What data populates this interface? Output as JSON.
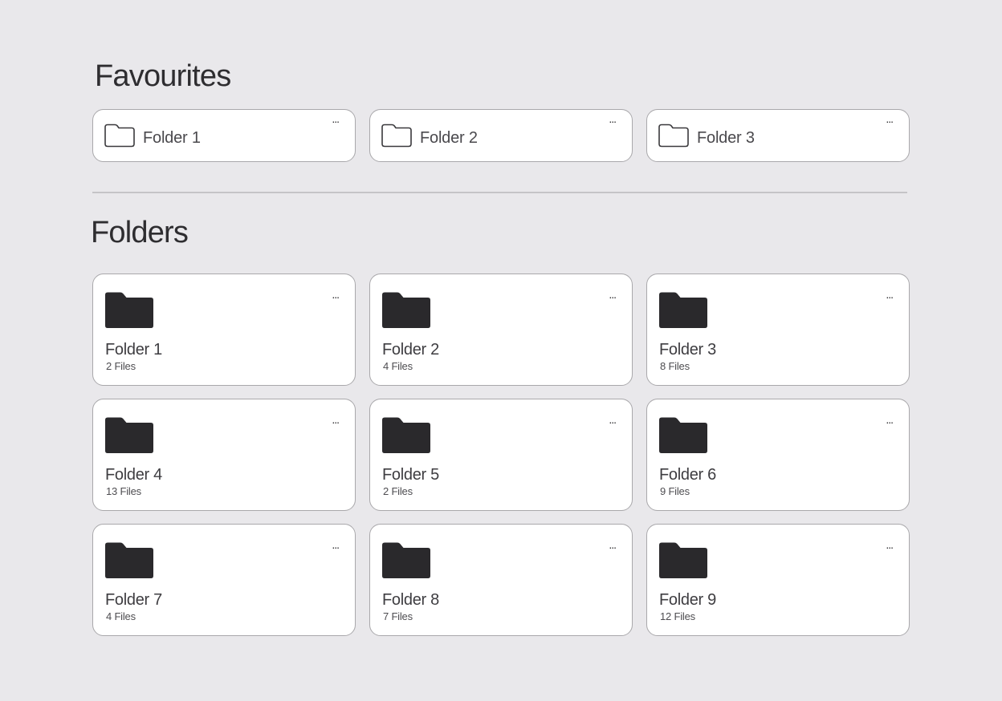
{
  "favourites": {
    "title": "Favourites",
    "items": [
      {
        "label": "Folder 1",
        "menu": "..."
      },
      {
        "label": "Folder 2",
        "menu": "..."
      },
      {
        "label": "Folder 3",
        "menu": "..."
      }
    ]
  },
  "folders": {
    "title": "Folders",
    "items": [
      {
        "name": "Folder 1",
        "count": "2 Files",
        "menu": "..."
      },
      {
        "name": "Folder 2",
        "count": "4 Files",
        "menu": "..."
      },
      {
        "name": "Folder 3",
        "count": "8 Files",
        "menu": "..."
      },
      {
        "name": "Folder 4",
        "count": "13 Files",
        "menu": "..."
      },
      {
        "name": "Folder 5",
        "count": "2 Files",
        "menu": "..."
      },
      {
        "name": "Folder 6",
        "count": "9 Files",
        "menu": "..."
      },
      {
        "name": "Folder 7",
        "count": "4 Files",
        "menu": "..."
      },
      {
        "name": "Folder 8",
        "count": "7 Files",
        "menu": "..."
      },
      {
        "name": "Folder 9",
        "count": "12 Files",
        "menu": "..."
      }
    ]
  },
  "icons": {
    "favourite_folder": "folder-outline-icon",
    "folder": "folder-filled-icon",
    "menu": "more-horizontal-icon"
  },
  "colors": {
    "background": "#e9e8eb",
    "card": "#ffffff",
    "card_border": "#a9a8ab",
    "folder_fill": "#2a292c",
    "text": "#2e2d30"
  }
}
